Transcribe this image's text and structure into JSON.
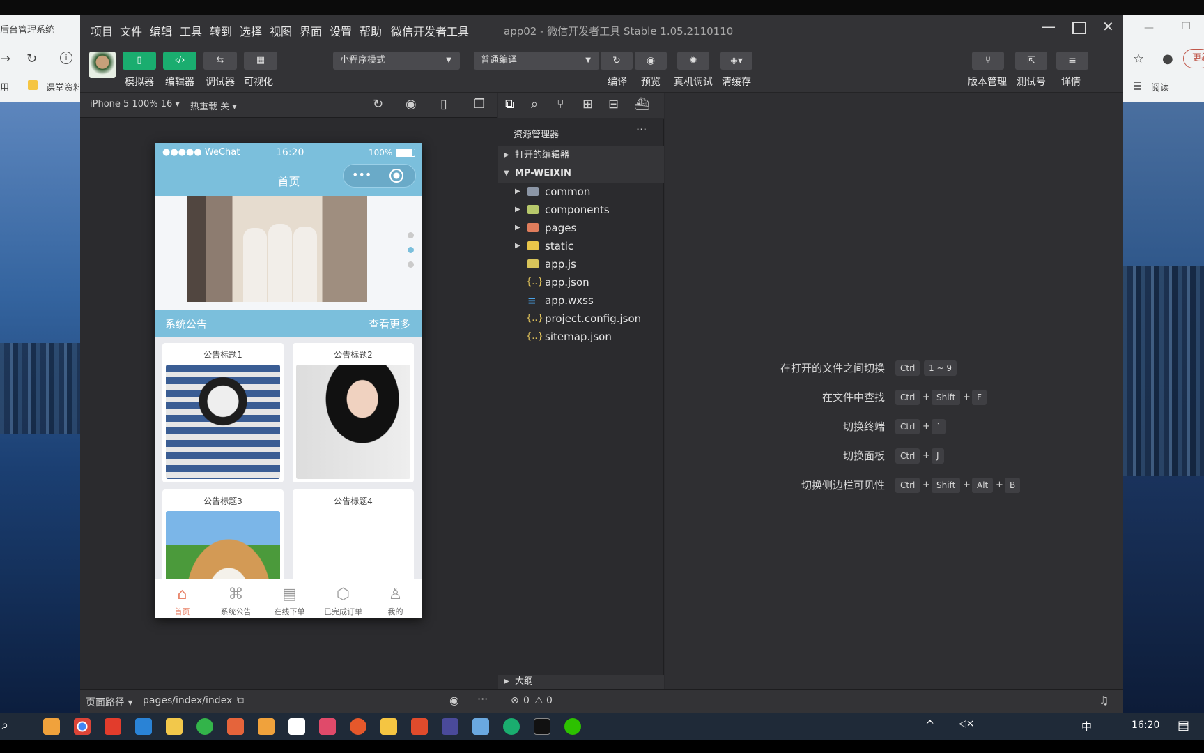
{
  "browser_left": {
    "tab_title": "后台管理系统",
    "bookmark1": "用",
    "bookmark2": "课堂资料"
  },
  "browser_right": {
    "update_btn": "更新",
    "bookmark": "阅读"
  },
  "menu": [
    "项目",
    "文件",
    "编辑",
    "工具",
    "转到",
    "选择",
    "视图",
    "界面",
    "设置",
    "帮助",
    "微信开发者工具"
  ],
  "window_title": "app02 - 微信开发者工具 Stable 1.05.2110110",
  "toolbar": {
    "left_buttons": [
      {
        "label": "模拟器",
        "icon": "phone-icon"
      },
      {
        "label": "编辑器",
        "icon": "code-icon"
      },
      {
        "label": "调试器",
        "icon": "debug-icon"
      },
      {
        "label": "可视化",
        "icon": "layout-icon"
      }
    ],
    "mode_select": "小程序模式",
    "compile_select": "普通编译",
    "mid_labels": [
      "编译",
      "预览",
      "真机调试",
      "清缓存"
    ],
    "right_labels": [
      "版本管理",
      "测试号",
      "详情"
    ]
  },
  "simulator": {
    "device": "iPhone 5 100% 16",
    "hot_reload": "热重载 关",
    "status_carrier": "●●●●● WeChat",
    "status_time": "16:20",
    "status_battery": "100%",
    "page_title": "首页",
    "notice_label": "系统公告",
    "notice_more": "查看更多",
    "cards": [
      {
        "title": "公告标题1"
      },
      {
        "title": "公告标题2"
      },
      {
        "title": "公告标题3"
      },
      {
        "title": "公告标题4"
      }
    ],
    "tabs": [
      {
        "label": "首页",
        "icon": "home-icon"
      },
      {
        "label": "系统公告",
        "icon": "grid-icon"
      },
      {
        "label": "在线下单",
        "icon": "keyboard-icon"
      },
      {
        "label": "已完成订单",
        "icon": "box-icon"
      },
      {
        "label": "我的",
        "icon": "user-icon"
      }
    ]
  },
  "explorer": {
    "header": "资源管理器",
    "open_editors": "打开的编辑器",
    "project": "MP-WEIXIN",
    "items": [
      {
        "name": "common",
        "type": "folder"
      },
      {
        "name": "components",
        "type": "folder"
      },
      {
        "name": "pages",
        "type": "folder"
      },
      {
        "name": "static",
        "type": "folder"
      },
      {
        "name": "app.js",
        "type": "js"
      },
      {
        "name": "app.json",
        "type": "json"
      },
      {
        "name": "app.wxss",
        "type": "wxss"
      },
      {
        "name": "project.config.json",
        "type": "json"
      },
      {
        "name": "sitemap.json",
        "type": "json"
      }
    ],
    "outline": "大纲"
  },
  "shortcuts": [
    {
      "label": "在打开的文件之间切换",
      "keys": [
        "Ctrl",
        "1 ~ 9"
      ]
    },
    {
      "label": "在文件中查找",
      "keys": [
        "Ctrl",
        "Shift",
        "F"
      ]
    },
    {
      "label": "切换终端",
      "keys": [
        "Ctrl",
        "`"
      ]
    },
    {
      "label": "切换面板",
      "keys": [
        "Ctrl",
        "J"
      ]
    },
    {
      "label": "切换侧边栏可见性",
      "keys": [
        "Ctrl",
        "Shift",
        "Alt",
        "B"
      ]
    }
  ],
  "statusbar": {
    "path_label": "页面路径",
    "path": "pages/index/index",
    "errors": "0",
    "warnings": "0"
  },
  "taskbar": {
    "ime": "中",
    "time": "16:20"
  }
}
